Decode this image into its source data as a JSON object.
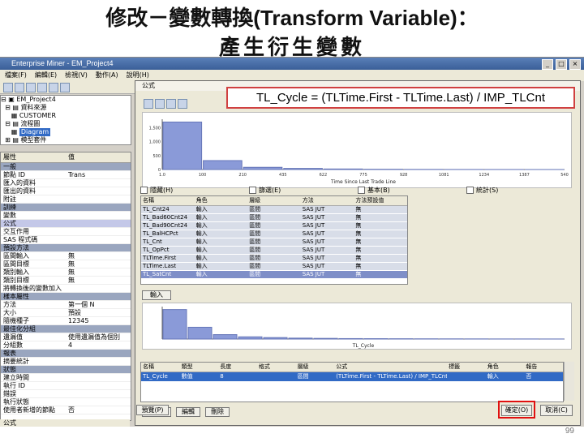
{
  "slide": {
    "title_line1_cn": "修改－變數轉換",
    "title_line1_en": "(Transform Variable)",
    "title_line1_colon": "：",
    "title_line2": "產生衍生變數",
    "callout": "TL_Cycle = (TLTime.First - TLTime.Last) / IMP_TLCnt",
    "page_number": "99"
  },
  "window": {
    "title": "Enterprise Miner - EM_Project4",
    "menu": [
      "檔案(F)",
      "編輯(E)",
      "檢視(V)",
      "動作(A)",
      "說明(H)"
    ]
  },
  "tree": {
    "items": [
      "EM_Project4",
      "資料來源",
      "CUSTOMER",
      "流程圖",
      "Diagram",
      "模型套件"
    ]
  },
  "props": {
    "col_property": "屬性",
    "col_value": "值",
    "rows": [
      {
        "k": "一般",
        "v": "",
        "type": "sec"
      },
      {
        "k": "節點 ID",
        "v": "Trans",
        "type": ""
      },
      {
        "k": "匯入的資料",
        "v": "",
        "type": ""
      },
      {
        "k": "匯出的資料",
        "v": "",
        "type": ""
      },
      {
        "k": "附註",
        "v": "",
        "type": ""
      },
      {
        "k": "訓練",
        "v": "",
        "type": "sec"
      },
      {
        "k": "變數",
        "v": "",
        "type": ""
      },
      {
        "k": "公式",
        "v": "",
        "type": "hl"
      },
      {
        "k": "交互作用",
        "v": "",
        "type": ""
      },
      {
        "k": "SAS 程式碼",
        "v": "",
        "type": ""
      },
      {
        "k": "預設方法",
        "v": "",
        "type": "sec"
      },
      {
        "k": "區間輸入",
        "v": "無",
        "type": ""
      },
      {
        "k": "區間目標",
        "v": "無",
        "type": ""
      },
      {
        "k": "類別輸入",
        "v": "無",
        "type": ""
      },
      {
        "k": "類別目標",
        "v": "無",
        "type": ""
      },
      {
        "k": "將轉換後的變數加入",
        "v": "",
        "type": ""
      },
      {
        "k": "樣本屬性",
        "v": "",
        "type": "sec"
      },
      {
        "k": "方法",
        "v": "第一個 N",
        "type": ""
      },
      {
        "k": "大小",
        "v": "預設",
        "type": ""
      },
      {
        "k": "隨機種子",
        "v": "12345",
        "type": ""
      },
      {
        "k": "最佳化分組",
        "v": "",
        "type": "sec"
      },
      {
        "k": "遺漏值",
        "v": "使用遺漏值為個別",
        "type": ""
      },
      {
        "k": "分組數",
        "v": "4",
        "type": ""
      },
      {
        "k": "報表",
        "v": "",
        "type": "sec"
      },
      {
        "k": "摘要統計",
        "v": "",
        "type": ""
      },
      {
        "k": "狀態",
        "v": "",
        "type": "sec"
      },
      {
        "k": "建立時間",
        "v": "",
        "type": ""
      },
      {
        "k": "執行 ID",
        "v": "",
        "type": ""
      },
      {
        "k": "錯誤",
        "v": "",
        "type": ""
      },
      {
        "k": "執行狀態",
        "v": "",
        "type": ""
      },
      {
        "k": "使用者新增的節點",
        "v": "否",
        "type": ""
      }
    ],
    "footer": "公式"
  },
  "dialog": {
    "title": "公式",
    "x_axis_label": "Time Since Last Trade Line",
    "checkboxes": [
      "隱藏(H)",
      "篩選(E)",
      "基本(B)",
      "統計(S)"
    ],
    "table_headers": [
      "名稱",
      "角色",
      "層級",
      "方法",
      "方法預設值"
    ],
    "table_rows": [
      [
        "TL_Cnt24",
        "輸入",
        "區間",
        "SAS JUT",
        "無"
      ],
      [
        "TL_Bad60Cnt24",
        "輸入",
        "區間",
        "SAS JUT",
        "無"
      ],
      [
        "TL_Bad90Cnt24",
        "輸入",
        "區間",
        "SAS JUT",
        "無"
      ],
      [
        "TL_BalHCPct",
        "輸入",
        "區間",
        "SAS JUT",
        "無"
      ],
      [
        "TL_Cnt",
        "輸入",
        "區間",
        "SAS JUT",
        "無"
      ],
      [
        "TL_OpPct",
        "輸入",
        "區間",
        "SAS JUT",
        "無"
      ],
      [
        "TLTime.First",
        "輸入",
        "區間",
        "SAS JUT",
        "無"
      ],
      [
        "TLTime.Last",
        "輸入",
        "區間",
        "SAS JUT",
        "無"
      ],
      [
        "TL_SatCnt",
        "輸入",
        "區間",
        "SAS JUT",
        "無"
      ]
    ],
    "input_button": "輸入",
    "bottom_x_label": "TL_Cycle",
    "var_headers": [
      "名稱",
      "類型",
      "長度",
      "格式",
      "層級",
      "公式",
      "標籤",
      "角色",
      "報告"
    ],
    "var_row": [
      "TL_Cycle",
      "數值",
      "8",
      "",
      "區間",
      "(TLTime.First - TLTime.Last) / IMP_TLCnt",
      "",
      "輸入",
      "否"
    ],
    "buttons": {
      "new": "新增",
      "edit": "編輯",
      "delete": "刪除",
      "preview": "預覽(P)",
      "ok": "確定(O)",
      "cancel": "取消(C)"
    }
  },
  "chart_data": [
    {
      "type": "bar",
      "title": "",
      "xlabel": "Time Since Last Trade Line",
      "x_ticks": [
        "1.0",
        "100",
        "210",
        "435",
        "622",
        "775",
        "928",
        "1081",
        "1234",
        "1387",
        "540"
      ],
      "y_ticks": [
        "0",
        "500",
        "1,000",
        "1,500"
      ],
      "values": [
        1700,
        320,
        80,
        40,
        20,
        10,
        5,
        3,
        2,
        1
      ]
    },
    {
      "type": "bar",
      "title": "",
      "xlabel": "TL_Cycle",
      "values": [
        800,
        320,
        120,
        60,
        40,
        25,
        18,
        12,
        10,
        8,
        6,
        5,
        4,
        3,
        3,
        2
      ]
    }
  ]
}
